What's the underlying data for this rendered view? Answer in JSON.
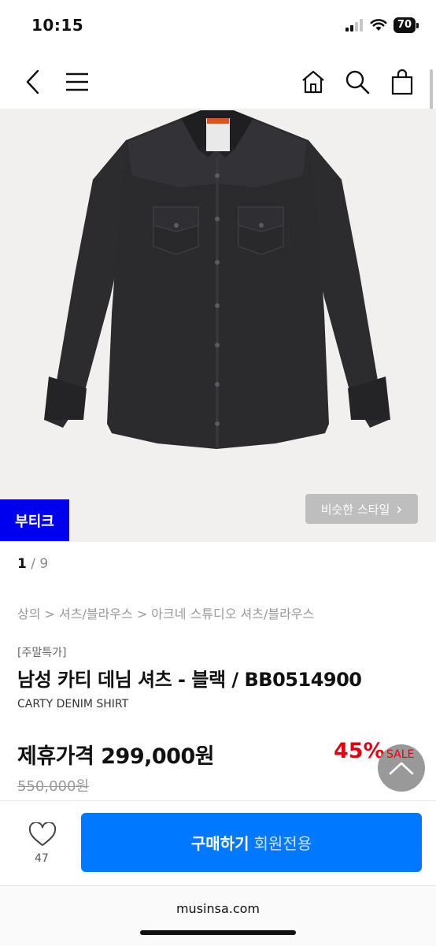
{
  "status": {
    "time": "10:15",
    "battery": "70"
  },
  "hero": {
    "boutique_label": "부티크",
    "similar_label": "비슷한 스타일",
    "similar_chevron": "›"
  },
  "pager": {
    "current": "1",
    "total": "/ 9"
  },
  "breadcrumb": "상의 > 셔츠/블라우스 > 아크네 스튜디오 셔츠/블라우스",
  "product": {
    "tag": "[주말특가]",
    "title": "남성 카티 데님 셔츠 - 블랙 / BB0514900",
    "subtitle": "CARTY DENIM SHIRT",
    "price_label": "제휴가격 299,000원",
    "discount": "45%",
    "sale_label": "SALE",
    "original_price": "550,000원"
  },
  "actions": {
    "like_count": "47",
    "buy_main": "구매하기",
    "buy_sub": "회원전용"
  },
  "browser": {
    "url": "musinsa.com"
  },
  "colors": {
    "accent": "#0078ff",
    "boutique": "#0000ee",
    "discount": "#e00012"
  },
  "icons": [
    "back-icon",
    "menu-icon",
    "home-icon",
    "search-icon",
    "bag-icon",
    "heart-icon",
    "chevron-up-icon",
    "signal-icon",
    "wifi-icon",
    "battery-icon"
  ]
}
